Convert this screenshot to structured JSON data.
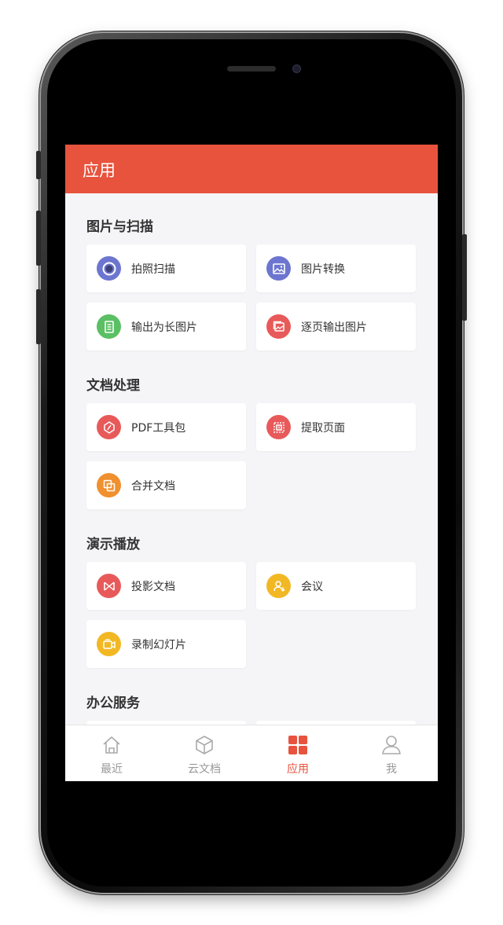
{
  "header": {
    "title": "应用"
  },
  "sections": [
    {
      "title": "图片与扫描",
      "items": [
        {
          "label": "拍照扫描",
          "icon": "camera-scan-icon",
          "color": "#6c75cf"
        },
        {
          "label": "图片转换",
          "icon": "image-icon",
          "color": "#6c75cf"
        },
        {
          "label": "输出为长图片",
          "icon": "long-image-icon",
          "color": "#5bbf63"
        },
        {
          "label": "逐页输出图片",
          "icon": "pages-image-icon",
          "color": "#e85a5a"
        }
      ]
    },
    {
      "title": "文档处理",
      "items": [
        {
          "label": "PDF工具包",
          "icon": "pdf-icon",
          "color": "#e85a5a"
        },
        {
          "label": "提取页面",
          "icon": "extract-page-icon",
          "color": "#e85a5a"
        },
        {
          "label": "合并文档",
          "icon": "merge-icon",
          "color": "#f0902e"
        }
      ]
    },
    {
      "title": "演示播放",
      "items": [
        {
          "label": "投影文档",
          "icon": "projection-icon",
          "color": "#e85a5a"
        },
        {
          "label": "会议",
          "icon": "meeting-icon",
          "color": "#f2b824"
        },
        {
          "label": "录制幻灯片",
          "icon": "record-icon",
          "color": "#f2b824"
        }
      ]
    },
    {
      "title": "办公服务",
      "items": []
    }
  ],
  "tabs": [
    {
      "label": "最近",
      "icon": "home-icon",
      "active": false
    },
    {
      "label": "云文档",
      "icon": "cube-icon",
      "active": false
    },
    {
      "label": "应用",
      "icon": "apps-grid-icon",
      "active": true
    },
    {
      "label": "我",
      "icon": "user-icon",
      "active": false
    }
  ],
  "colors": {
    "accent": "#e8533d",
    "background": "#f5f5f7"
  }
}
